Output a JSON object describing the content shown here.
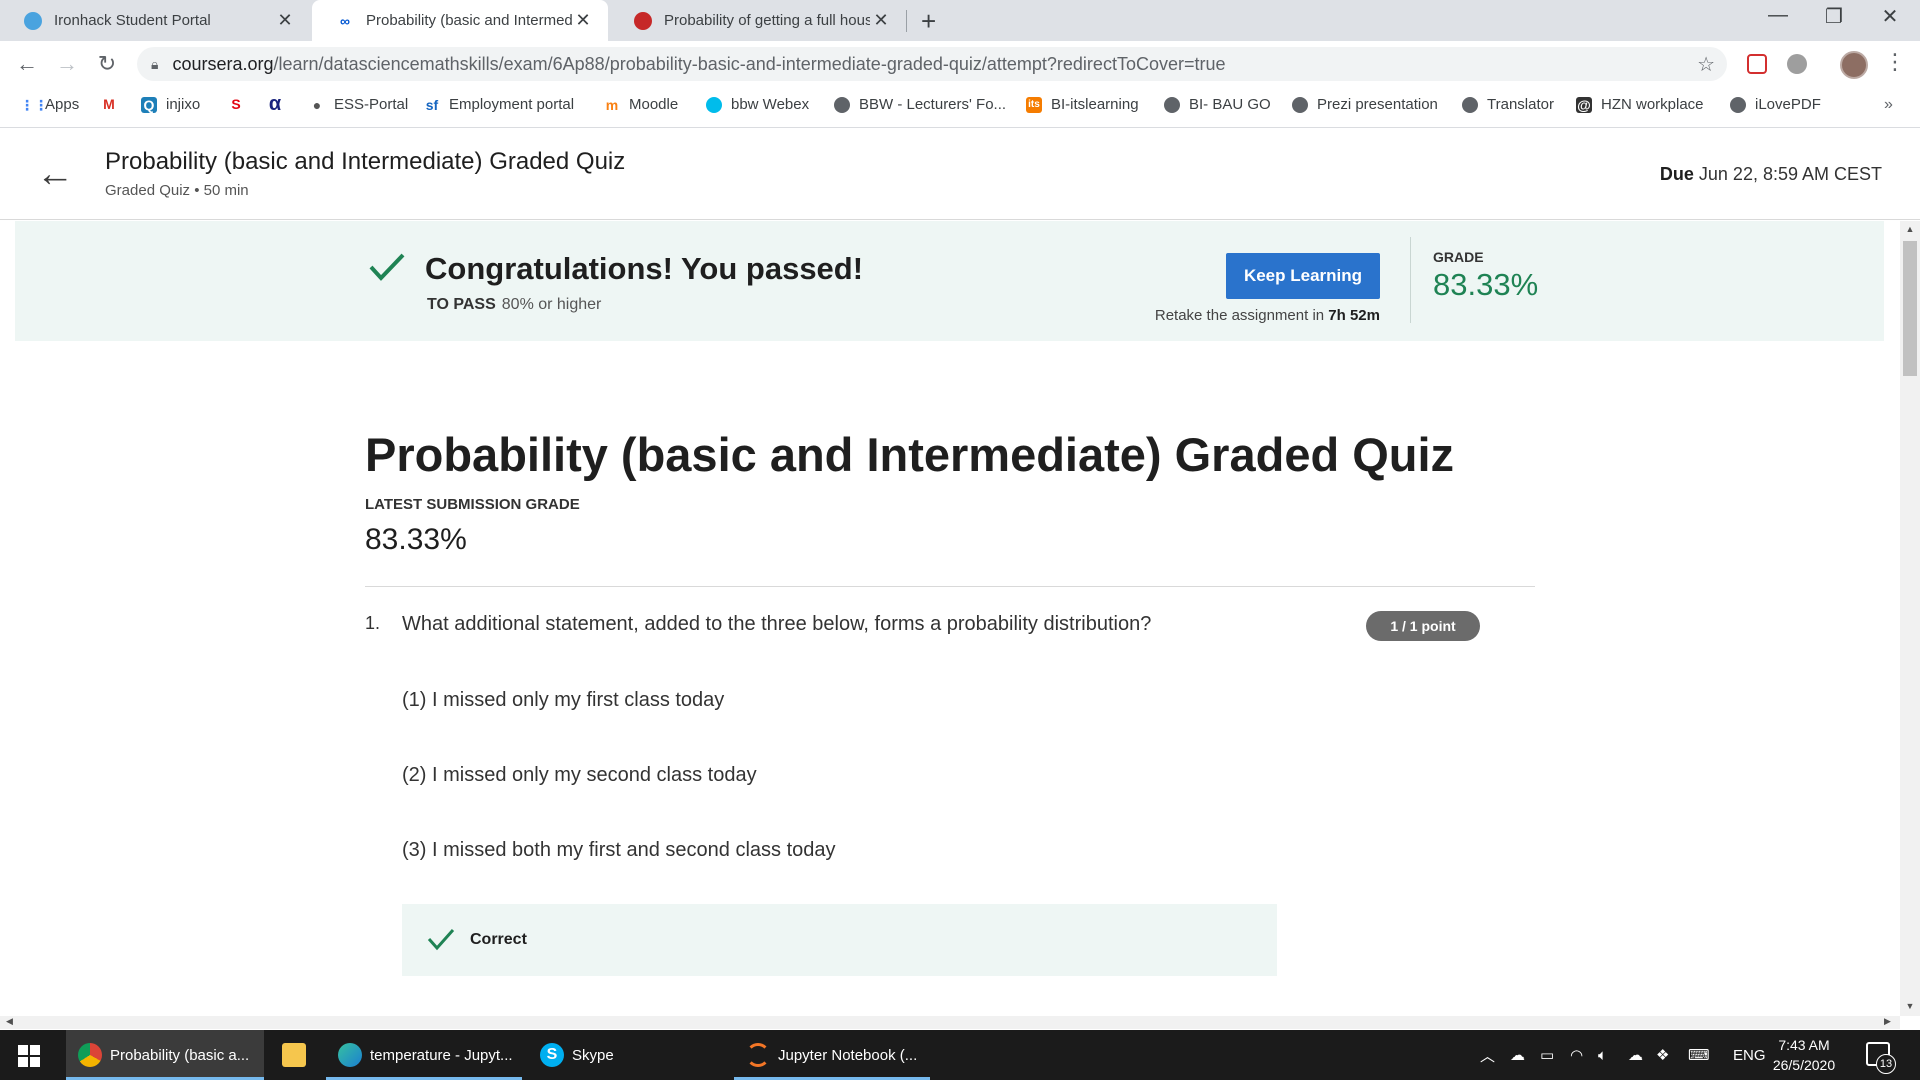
{
  "browser": {
    "tabs": [
      {
        "title": "Ironhack Student Portal",
        "color": "#4aa3df"
      },
      {
        "title": "Probability (basic and Intermedia",
        "color": "#0056d2"
      },
      {
        "title": "Probability of getting a full house",
        "color": "#c62828"
      }
    ],
    "address_bar": {
      "domain": "coursera.org",
      "path": "/learn/datasciencemathskills/exam/6Ap88/probability-basic-and-intermediate-graded-quiz/attempt?redirectToCover=true"
    },
    "bookmarks": [
      {
        "label": "Apps",
        "icon": "apps-grid-icon"
      },
      {
        "label": "",
        "icon": "gmail-icon"
      },
      {
        "label": "injixo",
        "icon": "injixo-icon"
      },
      {
        "label": "",
        "icon": "sparkasse-icon"
      },
      {
        "label": "",
        "icon": "alpha-icon"
      },
      {
        "label": "ESS-Portal",
        "icon": "apple-icon"
      },
      {
        "label": "Employment portal",
        "icon": "sf-icon"
      },
      {
        "label": "Moodle",
        "icon": "moodle-icon"
      },
      {
        "label": "bbw Webex",
        "icon": "webex-icon"
      },
      {
        "label": "BBW - Lecturers' Fo...",
        "icon": "globe-icon"
      },
      {
        "label": "BI-itslearning",
        "icon": "itslearning-icon"
      },
      {
        "label": "BI- BAU GO",
        "icon": "globe-icon"
      },
      {
        "label": "Prezi presentation",
        "icon": "globe-icon"
      },
      {
        "label": "Translator",
        "icon": "globe-icon"
      },
      {
        "label": "HZN workplace",
        "icon": "hzn-icon"
      },
      {
        "label": "iLovePDF",
        "icon": "globe-icon"
      }
    ],
    "bookmarks_more": "»"
  },
  "header": {
    "title": "Probability (basic and Intermediate) Graded Quiz",
    "subtitle": "Graded Quiz • 50 min",
    "due_label": "Due",
    "due_value": "Jun 22, 8:59 AM CEST"
  },
  "banner": {
    "message": "Congratulations! You passed!",
    "to_pass_label": "TO PASS",
    "to_pass_value": "80% or higher",
    "button_label": "Keep Learning",
    "retake_prefix": "Retake the assignment in",
    "retake_time": "7h 52m",
    "grade_label": "GRADE",
    "grade_value": "83.33%",
    "colors": {
      "background": "#eef6f4",
      "accent": "#1f8354",
      "button": "#2a73cc"
    }
  },
  "quiz": {
    "title": "Probability (basic and Intermediate) Graded Quiz",
    "latest_submission_label": "LATEST SUBMISSION GRADE",
    "latest_submission_value": "83.33%",
    "question": {
      "number": "1.",
      "text": "What additional statement, added to the three below, forms a probability distribution?",
      "points": "1 / 1 point",
      "statements": [
        "(1) I missed only my first class today",
        "(2) I missed only my second class today",
        "(3) I missed both my first and second class today"
      ],
      "feedback": "Correct"
    }
  },
  "taskbar": {
    "apps": [
      {
        "label": "Probability (basic a...",
        "icon": "chrome-icon",
        "active": true
      },
      {
        "label": "",
        "icon": "file-explorer-icon",
        "active": false
      },
      {
        "label": "temperature - Jupyt...",
        "icon": "edge-icon",
        "active": false
      },
      {
        "label": "Skype",
        "icon": "skype-icon",
        "active": false
      },
      {
        "label": "Jupyter Notebook (...",
        "icon": "jupyter-icon",
        "active": false
      }
    ],
    "language": "ENG",
    "time": "7:43 AM",
    "date": "26/5/2020",
    "notifications": "13"
  }
}
